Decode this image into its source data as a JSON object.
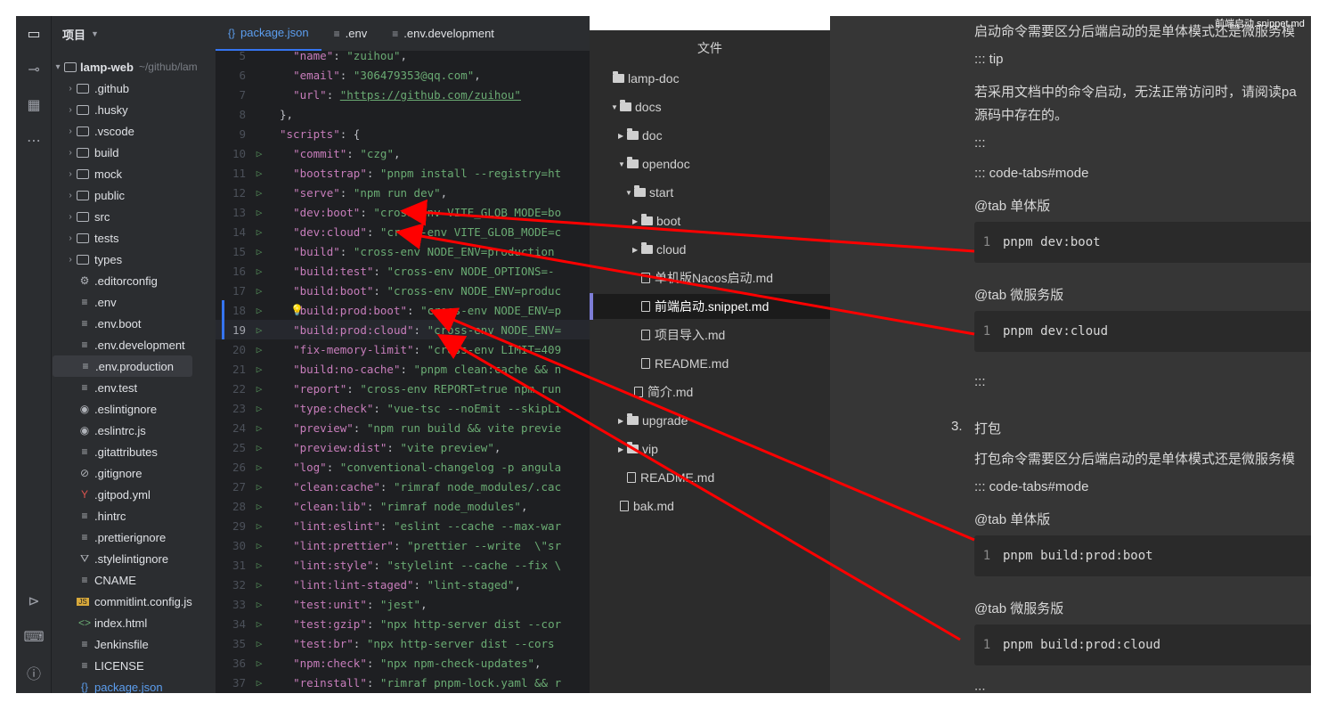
{
  "ide": {
    "project_header": "项目",
    "root": {
      "name": "lamp-web",
      "hint": "~/github/lam"
    },
    "tree": [
      {
        "label": ".github",
        "type": "folder"
      },
      {
        "label": ".husky",
        "type": "folder"
      },
      {
        "label": ".vscode",
        "type": "folder"
      },
      {
        "label": "build",
        "type": "folder"
      },
      {
        "label": "mock",
        "type": "folder"
      },
      {
        "label": "public",
        "type": "folder"
      },
      {
        "label": "src",
        "type": "folder"
      },
      {
        "label": "tests",
        "type": "folder"
      },
      {
        "label": "types",
        "type": "folder"
      },
      {
        "label": ".editorconfig",
        "type": "gear-icon"
      },
      {
        "label": ".env",
        "type": "lines-icon"
      },
      {
        "label": ".env.boot",
        "type": "lines-icon"
      },
      {
        "label": ".env.development",
        "type": "lines-icon"
      },
      {
        "label": ".env.production",
        "type": "lines-icon"
      },
      {
        "label": ".env.test",
        "type": "lines-icon"
      },
      {
        "label": ".eslintignore",
        "type": "eslint-icon"
      },
      {
        "label": ".eslintrc.js",
        "type": "eslint-icon"
      },
      {
        "label": ".gitattributes",
        "type": "lines-icon"
      },
      {
        "label": ".gitignore",
        "type": "ignore-icon"
      },
      {
        "label": ".gitpod.yml",
        "type": "yaml-icon"
      },
      {
        "label": ".hintrc",
        "type": "lines-icon"
      },
      {
        "label": ".prettierignore",
        "type": "lines-icon"
      },
      {
        "label": ".stylelintignore",
        "type": "stylelint-icon"
      },
      {
        "label": "CNAME",
        "type": "lines-icon"
      },
      {
        "label": "commitlint.config.js",
        "type": "js-icon"
      },
      {
        "label": "index.html",
        "type": "html-icon"
      },
      {
        "label": "Jenkinsfile",
        "type": "lines-icon"
      },
      {
        "label": "LICENSE",
        "type": "lines-icon"
      },
      {
        "label": "package.json",
        "type": "json-icon"
      }
    ],
    "tabs": [
      {
        "label": "package.json",
        "icon": "{}"
      },
      {
        "label": ".env",
        "icon": "≡"
      },
      {
        "label": ".env.development",
        "icon": "≡"
      }
    ],
    "code_lines": [
      {
        "n": "5",
        "key": "\"name\"",
        "val": "\"zuihou\"",
        "tail": ","
      },
      {
        "n": "6",
        "key": "\"email\"",
        "val": "\"306479353@qq.com\"",
        "tail": ","
      },
      {
        "n": "7",
        "key": "\"url\"",
        "val": "\"https://github.com/zuihou\"",
        "tail": ""
      },
      {
        "n": "8",
        "key": "",
        "val": "},",
        "tail": ""
      },
      {
        "n": "9",
        "key": "\"scripts\"",
        "val": "{",
        "tail": ""
      },
      {
        "n": "10",
        "key": "\"commit\"",
        "val": "\"czg\"",
        "tail": ","
      },
      {
        "n": "11",
        "key": "\"bootstrap\"",
        "val": "\"pnpm install --registry=ht",
        "tail": ""
      },
      {
        "n": "12",
        "key": "\"serve\"",
        "val": "\"npm run dev\"",
        "tail": ","
      },
      {
        "n": "13",
        "key": "\"dev:boot\"",
        "val": "\"cross-env VITE_GLOB_MODE=bo",
        "tail": ""
      },
      {
        "n": "14",
        "key": "\"dev:cloud\"",
        "val": "\"cross-env VITE_GLOB_MODE=c",
        "tail": ""
      },
      {
        "n": "15",
        "key": "\"build\"",
        "val": "\"cross-env NODE_ENV=production",
        "tail": ""
      },
      {
        "n": "16",
        "key": "\"build:test\"",
        "val": "\"cross-env NODE_OPTIONS=-",
        "tail": ""
      },
      {
        "n": "17",
        "key": "\"build:boot\"",
        "val": "\"cross-env NODE_ENV=produc",
        "tail": ""
      },
      {
        "n": "18",
        "key": "\"build:prod:boot\"",
        "val": "\"cross-env NODE_ENV=p",
        "tail": ""
      },
      {
        "n": "19",
        "key": "\"build:prod:cloud\"",
        "val": "\"cross-env NODE_ENV=",
        "tail": ""
      },
      {
        "n": "20",
        "key": "\"fix-memory-limit\"",
        "val": "\"cross-env LIMIT=409",
        "tail": ""
      },
      {
        "n": "21",
        "key": "\"build:no-cache\"",
        "val": "\"pnpm clean:cache && n",
        "tail": ""
      },
      {
        "n": "22",
        "key": "\"report\"",
        "val": "\"cross-env REPORT=true npm run",
        "tail": ""
      },
      {
        "n": "23",
        "key": "\"type:check\"",
        "val": "\"vue-tsc --noEmit --skipLi",
        "tail": ""
      },
      {
        "n": "24",
        "key": "\"preview\"",
        "val": "\"npm run build && vite previe",
        "tail": ""
      },
      {
        "n": "25",
        "key": "\"preview:dist\"",
        "val": "\"vite preview\"",
        "tail": ","
      },
      {
        "n": "26",
        "key": "\"log\"",
        "val": "\"conventional-changelog -p angula",
        "tail": ""
      },
      {
        "n": "27",
        "key": "\"clean:cache\"",
        "val": "\"rimraf node_modules/.cac",
        "tail": ""
      },
      {
        "n": "28",
        "key": "\"clean:lib\"",
        "val": "\"rimraf node_modules\"",
        "tail": ","
      },
      {
        "n": "29",
        "key": "\"lint:eslint\"",
        "val": "\"eslint --cache --max-war",
        "tail": ""
      },
      {
        "n": "30",
        "key": "\"lint:prettier\"",
        "val": "\"prettier --write  \\\"sr",
        "tail": ""
      },
      {
        "n": "31",
        "key": "\"lint:style\"",
        "val": "\"stylelint --cache --fix \\",
        "tail": ""
      },
      {
        "n": "32",
        "key": "\"lint:lint-staged\"",
        "val": "\"lint-staged\"",
        "tail": ","
      },
      {
        "n": "33",
        "key": "\"test:unit\"",
        "val": "\"jest\"",
        "tail": ","
      },
      {
        "n": "34",
        "key": "\"test:gzip\"",
        "val": "\"npx http-server dist --cor",
        "tail": ""
      },
      {
        "n": "35",
        "key": "\"test:br\"",
        "val": "\"npx http-server dist --cors",
        "tail": ""
      },
      {
        "n": "36",
        "key": "\"npm:check\"",
        "val": "\"npx npm-check-updates\"",
        "tail": ","
      },
      {
        "n": "37",
        "key": "\"reinstall\"",
        "val": "\"rimraf pnpm-lock.yaml && r",
        "tail": ""
      }
    ]
  },
  "file_panel": {
    "title": "文件",
    "items": [
      {
        "label": "lamp-doc",
        "kind": "folder",
        "depth": 0,
        "arrow": ""
      },
      {
        "label": "docs",
        "kind": "folder",
        "depth": 1,
        "arrow": "▼"
      },
      {
        "label": "doc",
        "kind": "folder",
        "depth": 2,
        "arrow": "▶"
      },
      {
        "label": "opendoc",
        "kind": "folder",
        "depth": 2,
        "arrow": "▼"
      },
      {
        "label": "start",
        "kind": "folder",
        "depth": 3,
        "arrow": "▼"
      },
      {
        "label": "boot",
        "kind": "folder",
        "depth": 4,
        "arrow": "▶"
      },
      {
        "label": "cloud",
        "kind": "folder",
        "depth": 4,
        "arrow": "▶"
      },
      {
        "label": "单机版Nacos启动.md",
        "kind": "file",
        "depth": 4,
        "arrow": ""
      },
      {
        "label": "前端启动.snippet.md",
        "kind": "file",
        "depth": 4,
        "arrow": "",
        "selected": true
      },
      {
        "label": "项目导入.md",
        "kind": "file",
        "depth": 4,
        "arrow": ""
      },
      {
        "label": "README.md",
        "kind": "file",
        "depth": 4,
        "arrow": ""
      },
      {
        "label": "简介.md",
        "kind": "file",
        "depth": 3,
        "arrow": ""
      },
      {
        "label": "upgrade",
        "kind": "folder",
        "depth": 2,
        "arrow": "▶"
      },
      {
        "label": "vip",
        "kind": "folder",
        "depth": 2,
        "arrow": "▶"
      },
      {
        "label": "README.md",
        "kind": "file",
        "depth": 2,
        "arrow": ""
      },
      {
        "label": "bak.md",
        "kind": "file",
        "depth": 1,
        "arrow": ""
      }
    ]
  },
  "preview": {
    "window_title": "前端启动.snippet.md",
    "line_top": "启动命令需要区分后端启动的是单体模式还是微服务模",
    "tip": "::: tip",
    "tip_body_1": "若采用文档中的命令启动，无法正常访问时，请阅读pa",
    "tip_body_2": "源码中存在的。",
    "close_1": ":::",
    "code_tabs_1": "::: code-tabs#mode",
    "tab_single_1": "@tab 单体版",
    "code_1": "pnpm dev:boot",
    "tab_micro_1": "@tab 微服务版",
    "code_2": "pnpm dev:cloud",
    "close_2": ":::",
    "step_num": "3.",
    "step_title": "打包",
    "step_body": "打包命令需要区分后端启动的是单体模式还是微服务模",
    "code_tabs_2": "::: code-tabs#mode",
    "tab_single_2": "@tab 单体版",
    "code_3": "pnpm build:prod:boot",
    "tab_micro_2": "@tab 微服务版",
    "code_4": "pnpm build:prod:cloud",
    "close_3": ":::",
    "code_line_no": "1"
  },
  "colors": {
    "arrow": "#ff0000",
    "accent": "#3574f0"
  }
}
